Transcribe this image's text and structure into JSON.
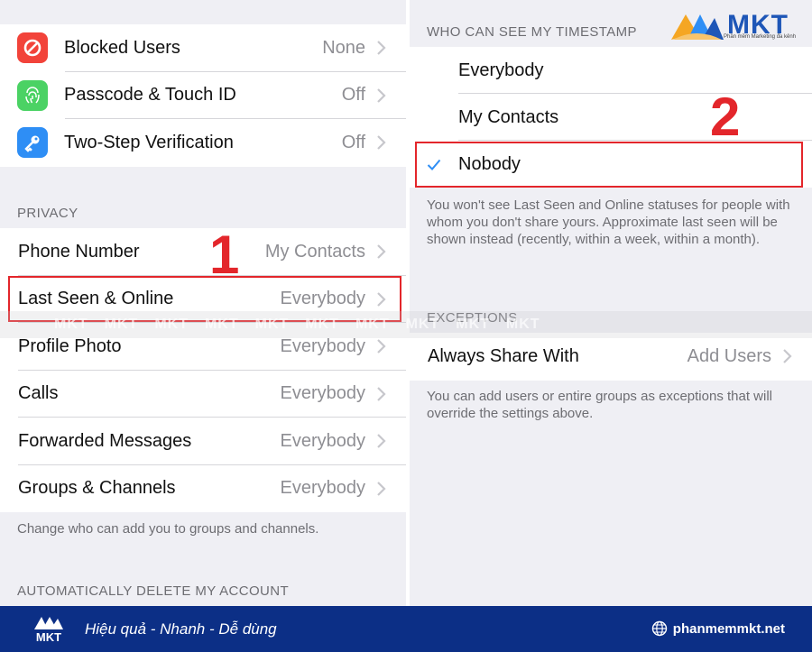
{
  "left": {
    "security_rows": [
      {
        "label": "Blocked Users",
        "value": "None",
        "icon": "blocked-icon",
        "color": "#f2433a"
      },
      {
        "label": "Passcode & Touch ID",
        "value": "Off",
        "icon": "fingerprint-icon",
        "color": "#4bd264"
      },
      {
        "label": "Two-Step Verification",
        "value": "Off",
        "icon": "key-icon",
        "color": "#2e8ef5"
      }
    ],
    "privacy_header": "PRIVACY",
    "privacy_rows": [
      {
        "label": "Phone Number",
        "value": "My Contacts"
      },
      {
        "label": "Last Seen & Online",
        "value": "Everybody"
      },
      {
        "label": "Profile Photo",
        "value": "Everybody"
      },
      {
        "label": "Calls",
        "value": "Everybody"
      },
      {
        "label": "Forwarded Messages",
        "value": "Everybody"
      },
      {
        "label": "Groups & Channels",
        "value": "Everybody"
      }
    ],
    "privacy_footer": "Change who can add you to groups and channels.",
    "delete_header": "AUTOMATICALLY DELETE MY ACCOUNT",
    "step_number": "1"
  },
  "right": {
    "header": "WHO CAN SEE MY TIMESTAMP",
    "options": [
      {
        "label": "Everybody",
        "selected": false
      },
      {
        "label": "My Contacts",
        "selected": false
      },
      {
        "label": "Nobody",
        "selected": true
      }
    ],
    "footer": "You won't see Last Seen and Online statuses for people with whom you don't share yours. Approximate last seen will be shown instead (recently, within a week, within a month).",
    "exceptions_header": "EXCEPTIONS",
    "exceptions_row": {
      "label": "Always Share With",
      "value": "Add Users"
    },
    "exceptions_footer": "You can add users or entire groups as exceptions that will override the settings above.",
    "step_number": "2"
  },
  "branding": {
    "logo_text": "MKT",
    "logo_sub": "Phần mềm Marketing đa kênh",
    "watermark": "MKT",
    "slogan": "Hiệu quả - Nhanh - Dễ dùng",
    "website": "phanmemmkt.net",
    "bottom_logo": "MKT"
  },
  "colors": {
    "accent": "#2e8ef5",
    "highlight": "#e3262b",
    "brand_blue": "#0c2f86"
  }
}
